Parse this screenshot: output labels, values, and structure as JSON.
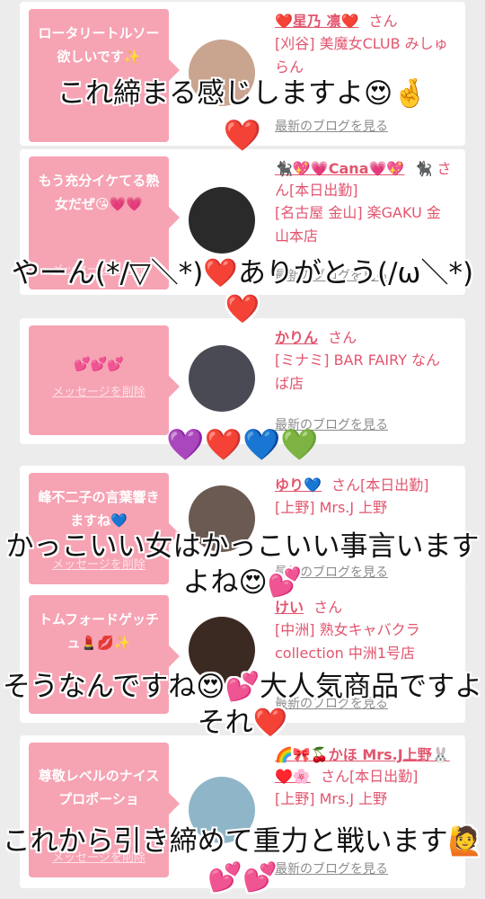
{
  "cards": [
    {
      "message": "ロータリートルソー欲しいです✨",
      "delete": "",
      "name": "❤️星乃 凛❤️",
      "san": "さん",
      "shop": "[刈谷] 美魔女CLUB みしゅらん",
      "blog": "最新のブログを見る",
      "avatar_color": "#c9a48f"
    },
    {
      "message": "もう充分イケてる熟女だぜ😘💗💗",
      "delete": "メッセージを削除",
      "name": "🐈‍⬛💖💗Cana💗💖",
      "san": "🐈‍⬛ さん[本日出勤]",
      "shop": "[名古屋 金山] 楽GAKU 金山本店",
      "blog": "最新のブログを見る",
      "avatar_color": "#2a2a2a"
    },
    {
      "message": "💕💕💕",
      "delete": "メッセージを削除",
      "name": "かりん",
      "san": "さん",
      "shop": "[ミナミ] BAR FAIRY なんば店",
      "blog": "最新のブログを見る",
      "avatar_color": "#4a4a55"
    },
    {
      "message": "峰不二子の言葉響きますね💙",
      "delete": "メッセージを削除",
      "name": "ゆり💙",
      "san": "さん[本日出勤]",
      "shop": "[上野] Mrs.J 上野",
      "blog": "最新のブログを見る",
      "avatar_color": "#6a5a52"
    },
    {
      "message": "トムフォードゲッチュ💄💋✨",
      "delete": "",
      "name": "けい",
      "san": "さん",
      "shop": "[中洲] 熟女キャバクラ collection 中洲1号店",
      "blog": "最新のブログを見る",
      "avatar_color": "#3a2a22"
    },
    {
      "message": "尊敬レベルのナイスプロポーショ",
      "delete": "メッセージを削除",
      "name": "🌈🎀🍒かほ Mrs.J上野🐰♥️🌸",
      "san": "さん[本日出勤]",
      "shop": "[上野] Mrs.J 上野",
      "blog": "最新のブログを見る",
      "avatar_color": "#8fb6c8"
    }
  ],
  "overlays": [
    "これ締まる感じしますよ😍🤞",
    "❤️",
    "やーん(*/▽＼*)❤️ありがとう(/ω＼*)❤️",
    "💜❤️💙💚",
    "かっこいい女はかっこいい事言いますよね😍💕",
    "そうなんですね😍💕大人気商品ですよそれ❤️",
    "これから引き締めて重力と戦います🙋💕💕"
  ]
}
